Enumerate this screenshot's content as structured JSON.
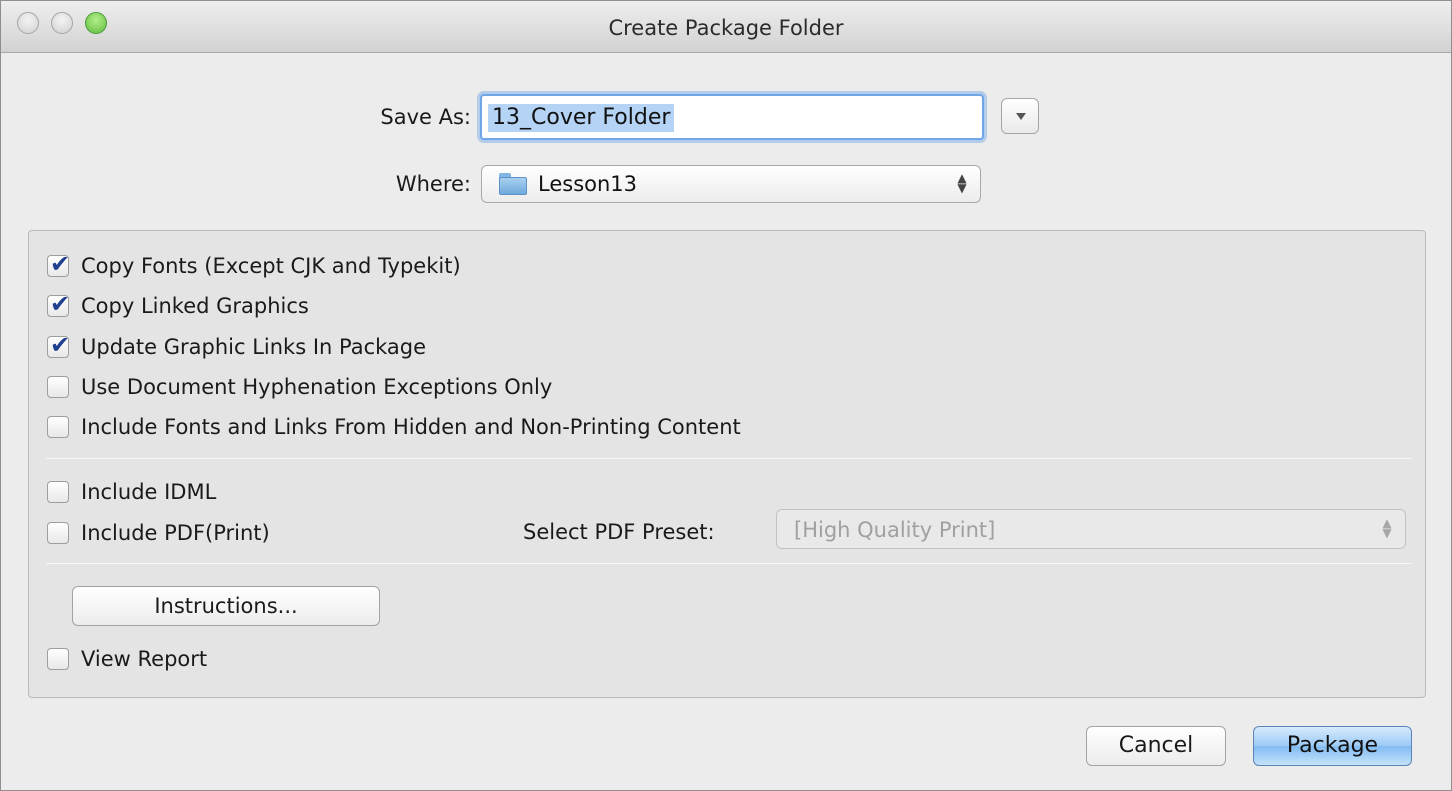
{
  "window": {
    "title": "Create Package Folder"
  },
  "save_as": {
    "label": "Save As:",
    "value": "13_Cover Folder"
  },
  "where": {
    "label": "Where:",
    "value": "Lesson13",
    "icon": "folder-icon"
  },
  "options": [
    {
      "label": "Copy Fonts (Except CJK and Typekit)",
      "checked": true
    },
    {
      "label": "Copy Linked Graphics",
      "checked": true
    },
    {
      "label": "Update Graphic Links In Package",
      "checked": true
    },
    {
      "label": "Use Document Hyphenation Exceptions Only",
      "checked": false
    },
    {
      "label": "Include Fonts and Links From Hidden and Non-Printing Content",
      "checked": false
    }
  ],
  "export_options": [
    {
      "label": "Include IDML",
      "checked": false
    },
    {
      "label": "Include PDF(Print)",
      "checked": false
    }
  ],
  "pdf_preset": {
    "label": "Select PDF Preset:",
    "value": "[High Quality Print]",
    "enabled": false
  },
  "instructions_label": "Instructions...",
  "view_report": {
    "label": "View Report",
    "checked": false
  },
  "buttons": {
    "cancel": "Cancel",
    "package": "Package"
  },
  "colors": {
    "focus_ring": "#6fa6e6",
    "selection": "#b5d3f5",
    "checkmark": "#1f3f8f",
    "default_button": "#9ccaf6"
  }
}
